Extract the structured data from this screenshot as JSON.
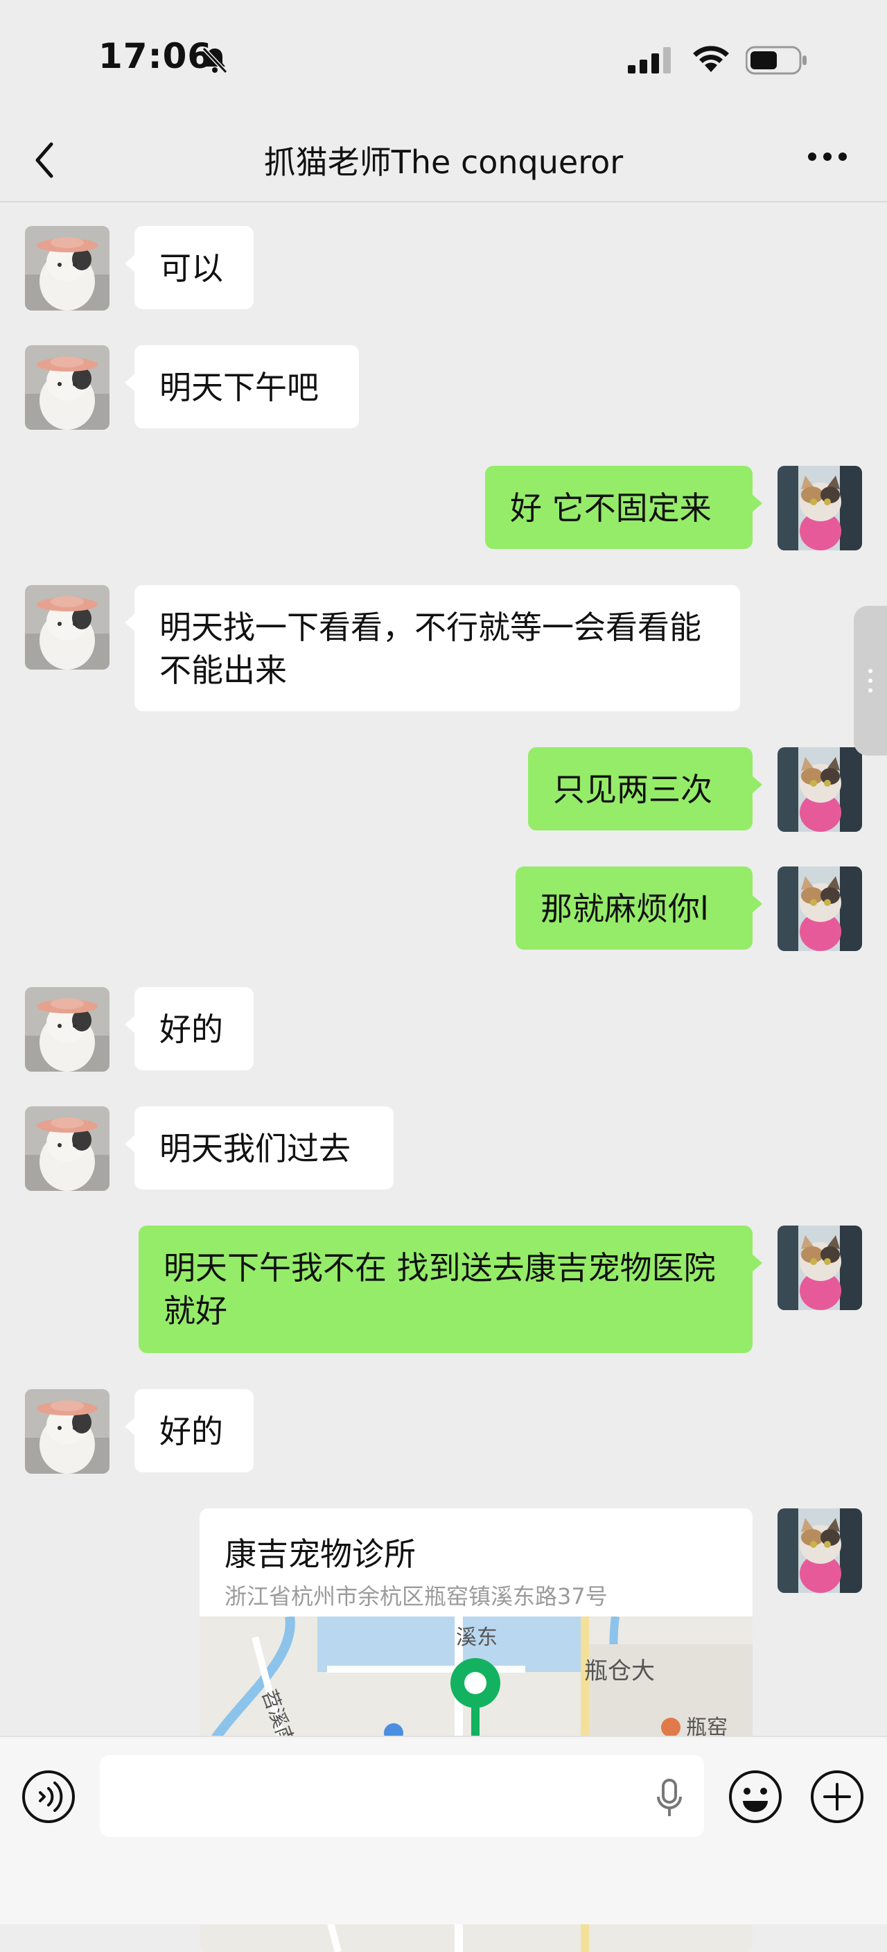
{
  "status_bar": {
    "time": "17:06",
    "icons": [
      "bell-slash-icon",
      "signal-icon",
      "wifi-icon",
      "battery-icon"
    ]
  },
  "header": {
    "title": "抓猫老师The conqueror",
    "back_icon": "chevron-left-icon",
    "more_icon": "more-dots-icon"
  },
  "colors": {
    "background": "#ededed",
    "incoming_bubble": "#ffffff",
    "outgoing_bubble": "#95ec69",
    "map_pin": "#13b260"
  },
  "messages": [
    {
      "from": "them",
      "text": "可以"
    },
    {
      "from": "them",
      "text": "明天下午吧"
    },
    {
      "from": "me",
      "text": "好 它不固定来"
    },
    {
      "from": "them",
      "text": "明天找一下看看，不行就等一会看看能不能出来"
    },
    {
      "from": "me",
      "text": "只见两三次"
    },
    {
      "from": "me",
      "text": "那就麻烦你l"
    },
    {
      "from": "them",
      "text": "好的"
    },
    {
      "from": "them",
      "text": "明天我们过去"
    },
    {
      "from": "me",
      "text": "明天下午我不在 找到送去康吉宠物医院就好"
    },
    {
      "from": "them",
      "text": "好的"
    }
  ],
  "location_card": {
    "from": "me",
    "name": "康吉宠物诊所",
    "address": "浙江省杭州市余杭区瓶窑镇溪东路37号",
    "map_labels": {
      "road_1": "溪东",
      "road_2": "瓶仓大",
      "road_3": "苕溪南",
      "poi": "瓶窑"
    }
  },
  "input_bar": {
    "voice_icon": "voice-icon",
    "mic_icon": "microphone-icon",
    "emoji_icon": "emoji-icon",
    "plus_icon": "plus-circle-icon"
  }
}
